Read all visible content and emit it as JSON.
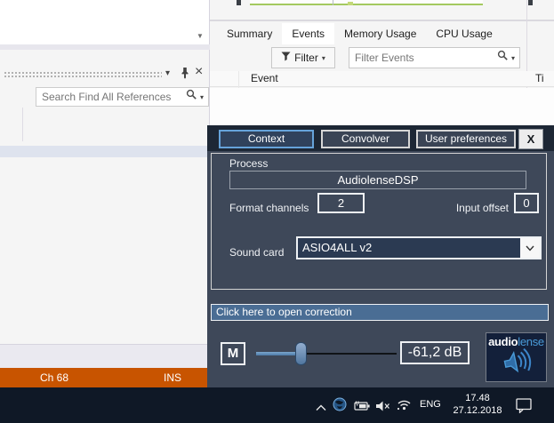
{
  "vs": {
    "find_references": {
      "search_placeholder": "Search Find All References"
    },
    "diagnostics": {
      "tabs": [
        "Summary",
        "Events",
        "Memory Usage",
        "CPU Usage"
      ],
      "active_tab": "Events",
      "filter_button_label": "Filter",
      "filter_search_placeholder": "Filter Events",
      "event_column": "Event",
      "time_column": "Ti"
    },
    "status_bar": {
      "channel": "Ch 68",
      "insert_mode": "INS"
    }
  },
  "dialog": {
    "tabs": [
      {
        "label": "Context",
        "active": true
      },
      {
        "label": "Convolver",
        "active": false
      },
      {
        "label": "User preferences",
        "active": false
      }
    ],
    "close_label": "X",
    "process": {
      "label": "Process",
      "value": "AudiolenseDSP"
    },
    "format_channels": {
      "label": "Format channels",
      "value": "2"
    },
    "input_offset": {
      "label": "Input offset",
      "value": "0"
    },
    "sound_card": {
      "label": "Sound card",
      "value": "ASIO4ALL v2"
    },
    "correction_link": "Click here to open correction",
    "mute_label": "M",
    "volume_readout": "-61,2 dB",
    "logo": {
      "part1": "audio",
      "part2": "lense"
    }
  },
  "taskbar": {
    "language": "ENG",
    "time": "17.48",
    "date": "27.12.2018"
  },
  "colors": {
    "dialog_bg": "#3e4859",
    "dialog_header": "#1d2735",
    "accent_blue": "#66a3da",
    "combo_selected_bg": "#2b3a52",
    "correction_bar": "#4a6d94",
    "status_orange": "#c85400",
    "taskbar_bg": "#0f1826",
    "logo_blue": "#4a9bd8",
    "chart_green": "#a4c960"
  }
}
